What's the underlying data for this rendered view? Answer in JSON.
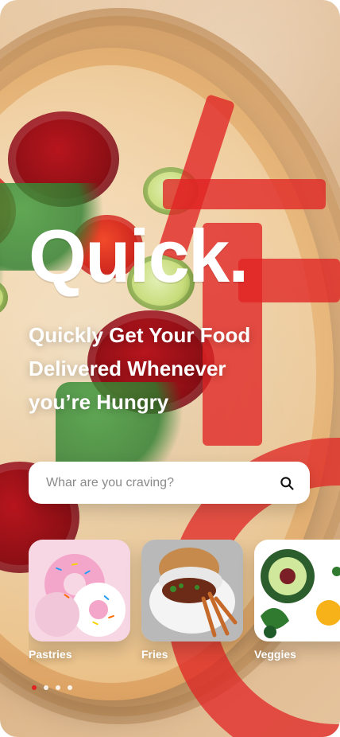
{
  "brand": {
    "logo": "Quick.",
    "accent": "#e02424"
  },
  "hero": {
    "headline": "Quickly Get Your Food Delivered Whenever you’re Hungry"
  },
  "search": {
    "placeholder": "Whar are you craving?",
    "icon": "search-icon"
  },
  "categories": [
    {
      "label": "Pastries"
    },
    {
      "label": "Fries"
    },
    {
      "label": "Veggies"
    }
  ],
  "pagination": {
    "active_index": 0,
    "count": 4
  }
}
